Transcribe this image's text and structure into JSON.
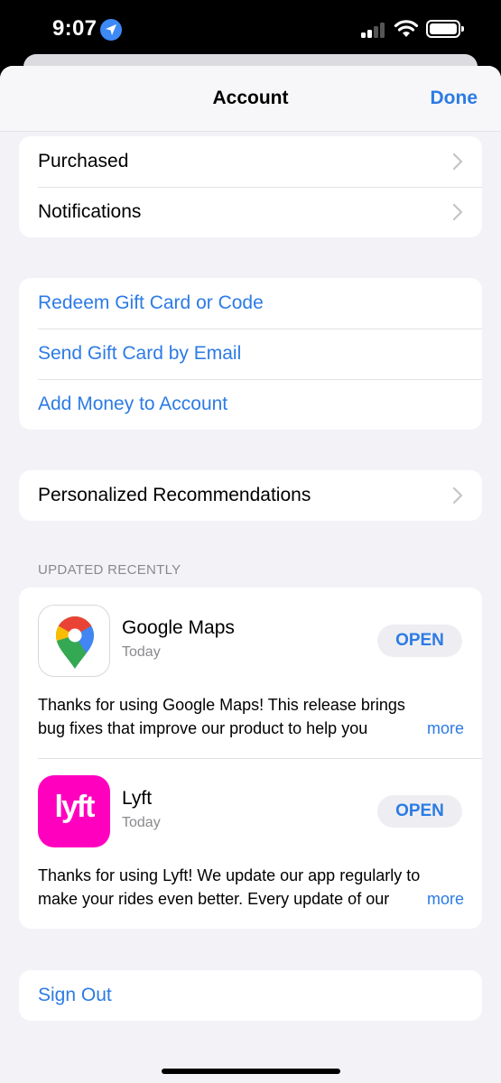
{
  "status": {
    "time": "9:07"
  },
  "nav": {
    "title": "Account",
    "done": "Done"
  },
  "group1": [
    {
      "label": "Purchased"
    },
    {
      "label": "Notifications"
    }
  ],
  "group2": [
    {
      "label": "Redeem Gift Card or Code"
    },
    {
      "label": "Send Gift Card by Email"
    },
    {
      "label": "Add Money to Account"
    }
  ],
  "group3": [
    {
      "label": "Personalized Recommendations"
    }
  ],
  "updated": {
    "header": "UPDATED RECENTLY",
    "apps": [
      {
        "name": "Google Maps",
        "date": "Today",
        "button": "OPEN",
        "notes_line1": "Thanks for using Google Maps! This release brings",
        "notes_line2": "bug fixes that improve our product to help you",
        "more": "more",
        "icon": "google-maps-icon"
      },
      {
        "name": "Lyft",
        "date": "Today",
        "button": "OPEN",
        "notes_line1": "Thanks for using Lyft! We update our app regularly to",
        "notes_line2": "make your rides even better. Every update of our",
        "more": "more",
        "icon": "lyft-icon",
        "icon_text": "lyft"
      }
    ]
  },
  "signout": {
    "label": "Sign Out"
  },
  "colors": {
    "accent": "#2c7be5",
    "background": "#f2f2f7",
    "lyft": "#ff00bf"
  }
}
